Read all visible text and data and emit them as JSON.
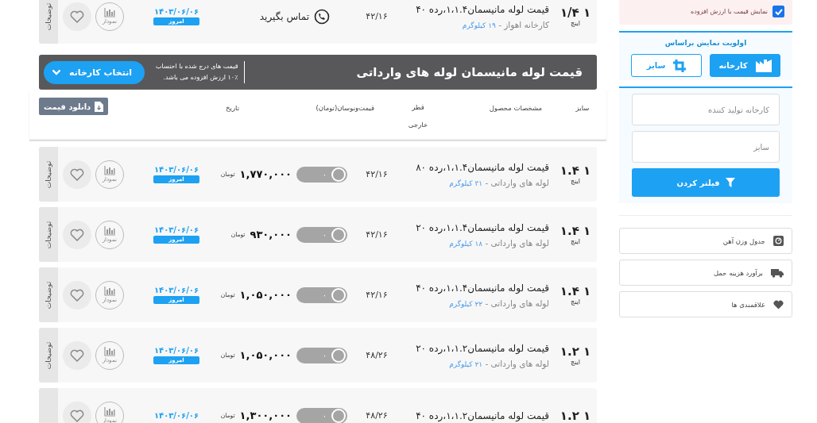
{
  "main": {
    "rows_above": [
      {
        "kind": "contact",
        "size": "۱ ۱/۴",
        "unit": "اینچ",
        "title": "قیمت لوله مانیسمان۱،۱.۴،رده ۴۰",
        "source": "کارخانه اهواز - ",
        "weight": "۱۹ کیلوگرم",
        "diameter": "۴۲/۱۶",
        "contact": "تماس بگیرید",
        "date": "۱۴۰۳/۰۶/۰۶",
        "badge": "امروز",
        "chart_label": "نمودار",
        "notes_label": "توضیحات"
      }
    ],
    "banner": {
      "title": "قیمت لوله مانیسمان لوله های وارداتی",
      "note_lines": [
        "قیمت های درج شده با احتساب",
        "۱۰٪ ارزش افزوده می باشد."
      ],
      "button": "انتخاب کارخانه"
    },
    "download_button": "دانلود قیمت",
    "columns": [
      "سایز",
      "مشخصات محصول",
      "قطر خارجی",
      "قیمت‌ونوسان(تومان)",
      "تاریخ"
    ],
    "rows": [
      {
        "kind": "price",
        "size": "۱ ۱.۴",
        "unit": "اینچ",
        "title": "قیمت لوله مانیسمان۱،۱.۴،رده ۸۰",
        "source": "لوله های وارداتی - ",
        "weight": "۳۱ کیلوگرم",
        "diameter": "۴۲/۱۶",
        "change": "۰",
        "price": "۱,۷۷۰,۰۰۰",
        "currency": "تومان",
        "date": "۱۴۰۳/۰۶/۰۶",
        "badge": "امروز",
        "chart_label": "نمودار",
        "notes_label": "توضیحات"
      },
      {
        "kind": "price",
        "size": "۱ ۱.۴",
        "unit": "اینچ",
        "title": "قیمت لوله مانیسمان۱،۱.۴،رده ۲۰",
        "source": "لوله های وارداتی - ",
        "weight": "۱۸ کیلوگرم",
        "diameter": "۴۲/۱۶",
        "change": "۰",
        "price": "۹۳۰,۰۰۰",
        "currency": "تومان",
        "date": "۱۴۰۳/۰۶/۰۶",
        "badge": "امروز",
        "chart_label": "نمودار",
        "notes_label": "توضیحات"
      },
      {
        "kind": "price",
        "size": "۱ ۱.۴",
        "unit": "اینچ",
        "title": "قیمت لوله مانیسمان۱،۱.۴،رده ۴۰",
        "source": "لوله های وارداتی - ",
        "weight": "۲۲ کیلوگرم",
        "diameter": "۴۲/۱۶",
        "change": "۰",
        "price": "۱,۰۵۰,۰۰۰",
        "currency": "تومان",
        "date": "۱۴۰۳/۰۶/۰۶",
        "badge": "امروز",
        "chart_label": "نمودار",
        "notes_label": "توضیحات"
      },
      {
        "kind": "price",
        "size": "۱ ۱.۲",
        "unit": "اینچ",
        "title": "قیمت لوله مانیسمان۱،۱.۲،رده ۲۰",
        "source": "لوله های وارداتی - ",
        "weight": "۲۱ کیلوگرم",
        "diameter": "۴۸/۲۶",
        "change": "۰",
        "price": "۱,۰۵۰,۰۰۰",
        "currency": "تومان",
        "date": "۱۴۰۳/۰۶/۰۶",
        "badge": "امروز",
        "chart_label": "نمودار",
        "notes_label": "توضیحات"
      },
      {
        "kind": "price",
        "size": "۱ ۱.۲",
        "title": "قیمت لوله مانیسمان۱،۱.۲،رده ۴۰",
        "diameter": "۴۸/۲۶",
        "change": "۰",
        "price": "۱,۳۰۰,۰۰۰",
        "currency": "تومان",
        "date": "۱۴۰۳/۰۶/۰۶",
        "chart_label": "نمودار"
      }
    ]
  },
  "sidebar": {
    "vat_toggle": {
      "label": "نمایش قیمت با ارزش افزوده",
      "checked": true
    },
    "priority": {
      "title": "اولویت نمایش براساس",
      "options": [
        {
          "kind": "factory",
          "label": "کارخانه",
          "selected": true
        },
        {
          "kind": "size",
          "label": "سایز",
          "selected": false
        }
      ]
    },
    "filter": {
      "fields": [
        {
          "placeholder": "کارخانه تولید کننده"
        },
        {
          "placeholder": "سایز"
        }
      ],
      "button": "فیلتر کردن"
    },
    "links": [
      {
        "kind": "weight-table",
        "label": "جدول وزن آهن"
      },
      {
        "kind": "shipping",
        "label": "برآورد هزینه حمل"
      },
      {
        "kind": "favorites",
        "label": "علاقمندی ها"
      }
    ]
  }
}
